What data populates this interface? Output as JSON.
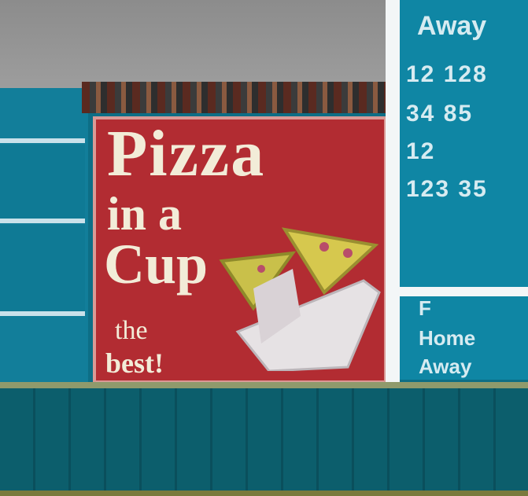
{
  "ad": {
    "line1": "Pizza",
    "line2": "in a",
    "line3": "Cup",
    "line4": "the",
    "line5": "best!",
    "graphic": "pizza-slice-in-cup-icon"
  },
  "scoreboard": {
    "top_header": "Away",
    "rows": [
      "12 128",
      "34 85",
      "12",
      "123 35"
    ],
    "bottom_lines": [
      "F",
      "Home",
      "Away"
    ]
  },
  "colors": {
    "ad_red": "#b22c32",
    "board_teal": "#0f86a4",
    "ad_text": "#f2ecd8"
  }
}
